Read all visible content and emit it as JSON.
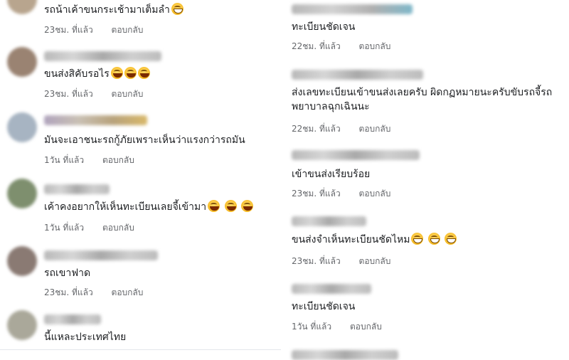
{
  "meta": {
    "time_suffix": "ที่แล้ว",
    "reply_label": "ตอบกลับ"
  },
  "left_comments": [
    {
      "text": "รถน้าเค้าขนกระเช้ามาเต็มลำ",
      "emojis": [
        "grin"
      ],
      "time": "23ชม."
    },
    {
      "text": "ขนส่งสิคับรอไร",
      "emojis": [
        "laugh",
        "laugh",
        "laugh"
      ],
      "time": "23ชม."
    },
    {
      "text": "มันจะเอาชนะรถกู้ภัยเพราะเห็นว่าแรงกว่ารถมัน",
      "emojis": [],
      "time": "1วัน"
    },
    {
      "text": "เค้าคงอยากให้เห็นทะเบียนเลยจี้เข้ามา",
      "emojis": [
        "laugh",
        "laugh",
        "laugh"
      ],
      "time": "1วัน"
    },
    {
      "text": "รถเขาฟาด",
      "emojis": [],
      "time": "23ชม."
    },
    {
      "text": "นี้แหละประเทศไทย",
      "emojis": [],
      "time": ""
    }
  ],
  "right_comments": [
    {
      "text": "ทะเบียนชัดเจน",
      "emojis": [],
      "time": "22ชม."
    },
    {
      "text": "ส่งเลขทะเบียนเข้าขนส่งเลยครับ ผิดกฏหมายนะครับขับรถจี้รถพยาบาลฉุกเฉินนะ",
      "emojis": [],
      "time": "22ชม."
    },
    {
      "text": "เข้าขนส่งเรียบร้อย",
      "emojis": [],
      "time": "23ชม."
    },
    {
      "text": "ขนส่งจำเห็นทะเบียนชัดไหม",
      "emojis": [
        "grin",
        "grin",
        "grin"
      ],
      "time": "23ชม."
    },
    {
      "text": "ทะเบียนชัดเจน",
      "emojis": [],
      "time": "1วัน"
    }
  ],
  "colors": {
    "text": "#1c1e21",
    "meta": "#65676b",
    "emoji": "#f5b820"
  }
}
